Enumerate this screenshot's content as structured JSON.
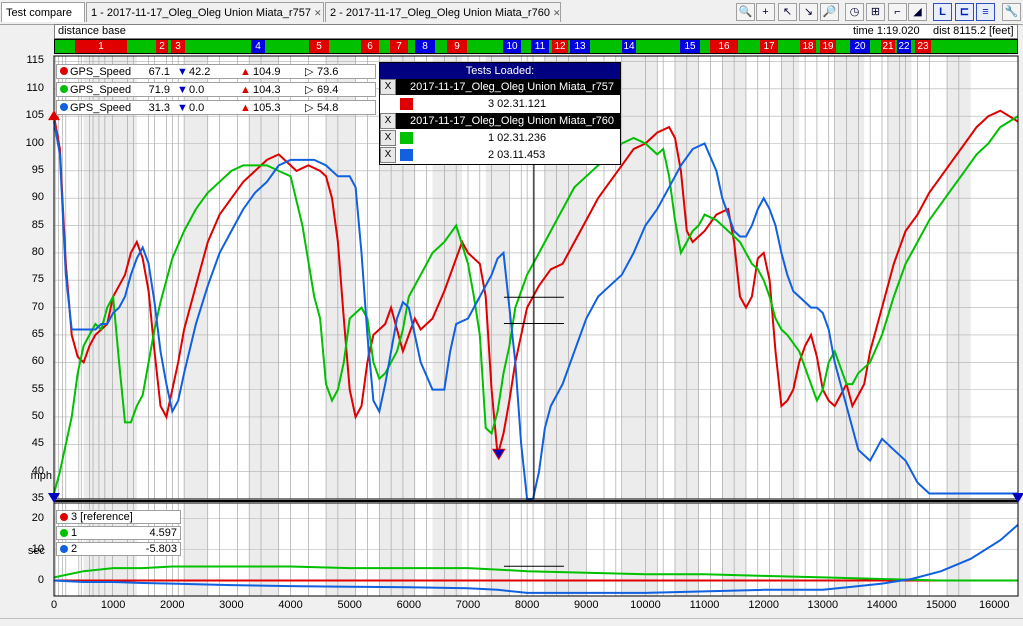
{
  "tabs": [
    {
      "label": "Test compare",
      "closable": false
    },
    {
      "label": "1 - 2017-11-17_Oleg_Oleg Union Miata_r757",
      "closable": true
    },
    {
      "label": "2 - 2017-11-17_Oleg_Oleg Union Miata_r760",
      "closable": true
    }
  ],
  "toolbar": {
    "buttons": [
      {
        "name": "zoom-in-icon",
        "glyph": "🔍"
      },
      {
        "name": "zoom-plus-icon",
        "glyph": "+"
      },
      {
        "name": "cursor-icon",
        "glyph": "↖"
      },
      {
        "name": "cursor-down-icon",
        "glyph": "↘"
      },
      {
        "name": "search-icon",
        "glyph": "🔎"
      },
      {
        "name": "clock-icon",
        "glyph": "◷"
      },
      {
        "name": "grid-icon",
        "glyph": "⊞"
      },
      {
        "name": "track-icon",
        "glyph": "⌐"
      },
      {
        "name": "triangle-icon",
        "glyph": "◢"
      },
      {
        "name": "layout-l-icon",
        "glyph": "L"
      },
      {
        "name": "layout-split-icon",
        "glyph": "⊏"
      },
      {
        "name": "layout-lines-icon",
        "glyph": "≡"
      },
      {
        "name": "wrench-icon",
        "glyph": "🔧"
      }
    ]
  },
  "infobar": {
    "label": "distance base",
    "time": "time 1:19.020",
    "dist": "dist 8115.2 [feet]"
  },
  "segments": [
    {
      "label": "1",
      "color": "#e00000"
    },
    {
      "label": "2",
      "color": "#e00000"
    },
    {
      "label": "3",
      "color": "#e00000"
    },
    {
      "label": "4",
      "color": "#0000e0"
    },
    {
      "label": "5",
      "color": "#e00000"
    },
    {
      "label": "6",
      "color": "#e00000"
    },
    {
      "label": "7",
      "color": "#e00000"
    },
    {
      "label": "8",
      "color": "#0000e0"
    },
    {
      "label": "9",
      "color": "#e00000"
    },
    {
      "label": "10",
      "color": "#0000e0"
    },
    {
      "label": "11",
      "color": "#0000e0"
    },
    {
      "label": "12",
      "color": "#e00000"
    },
    {
      "label": "13",
      "color": "#0000e0"
    },
    {
      "label": "14",
      "color": "#0000e0"
    },
    {
      "label": "15",
      "color": "#0000e0"
    },
    {
      "label": "16",
      "color": "#e00000"
    },
    {
      "label": "17",
      "color": "#e00000"
    },
    {
      "label": "18",
      "color": "#e00000"
    },
    {
      "label": "19",
      "color": "#e00000"
    },
    {
      "label": "20",
      "color": "#0000e0"
    },
    {
      "label": "21",
      "color": "#e00000"
    },
    {
      "label": "22",
      "color": "#0000e0"
    },
    {
      "label": "23",
      "color": "#e00000"
    }
  ],
  "legend": [
    {
      "name": "GPS_Speed",
      "value": "67.1",
      "min": "42.2",
      "max": "104.9",
      "avg": "73.6",
      "color": "#e00000"
    },
    {
      "name": "GPS_Speed",
      "value": "71.9",
      "min": "0.0",
      "max": "104.3",
      "avg": "69.4",
      "color": "#00c000"
    },
    {
      "name": "GPS_Speed",
      "value": "31.3",
      "min": "0.0",
      "max": "105.3",
      "avg": "54.8",
      "color": "#1060e0"
    }
  ],
  "tests_loaded": {
    "title": "Tests Loaded:",
    "groups": [
      {
        "session": "2017-11-17_Oleg_Oleg Union Miata_r757",
        "laps": [
          {
            "label": "3 02.31.121",
            "color": "#e00000"
          }
        ]
      },
      {
        "session": "2017-11-17_Oleg_Oleg Union Miata_r760",
        "laps": [
          {
            "label": "1 02.31.236",
            "color": "#00c000"
          },
          {
            "label": "2 03.11.453",
            "color": "#1060e0"
          }
        ]
      }
    ],
    "close_glyph": "X"
  },
  "bottom_legend": [
    {
      "label": "3 [reference]",
      "value": "",
      "color": "#e00000"
    },
    {
      "label": "1",
      "value": "4.597",
      "color": "#00c000"
    },
    {
      "label": "2",
      "value": "-5.803",
      "color": "#1060e0"
    }
  ],
  "chart_data": [
    {
      "type": "line",
      "ylabel": "mph",
      "xlabel": "",
      "ylim": [
        35,
        116
      ],
      "xlim": [
        0,
        16300
      ],
      "yticks": [
        35,
        40,
        45,
        50,
        55,
        60,
        65,
        70,
        75,
        80,
        85,
        90,
        95,
        100,
        105,
        110,
        115
      ],
      "xticks": [
        0,
        1000,
        2000,
        3000,
        4000,
        5000,
        6000,
        7000,
        8000,
        9000,
        10000,
        11000,
        12000,
        13000,
        14000,
        15000,
        16000
      ],
      "series": [
        {
          "name": "GPS_Speed",
          "color": "#e00000",
          "x": [
            0,
            100,
            200,
            300,
            400,
            500,
            600,
            700,
            800,
            900,
            1000,
            1100,
            1200,
            1300,
            1400,
            1500,
            1600,
            1700,
            1800,
            1900,
            2000,
            2100,
            2200,
            2400,
            2600,
            2800,
            3000,
            3200,
            3400,
            3600,
            3800,
            4000,
            4100,
            4300,
            4500,
            4600,
            4700,
            4800,
            4900,
            5000,
            5100,
            5200,
            5300,
            5400,
            5600,
            5700,
            5800,
            5900,
            6000,
            6100,
            6200,
            6400,
            6600,
            6800,
            6900,
            7000,
            7200,
            7300,
            7400,
            7500,
            7600,
            7700,
            7800,
            8000,
            8200,
            8400,
            8600,
            8800,
            9000,
            9200,
            9400,
            9600,
            9800,
            10000,
            10200,
            10400,
            10500,
            10600,
            10700,
            10800,
            10900,
            11000,
            11200,
            11400,
            11500,
            11600,
            11700,
            11800,
            11900,
            12000,
            12100,
            12200,
            12300,
            12400,
            12500,
            12600,
            12700,
            12800,
            12900,
            13000,
            13100,
            13200,
            13300,
            13400,
            13500,
            13600,
            13700,
            13800,
            14000,
            14200,
            14400,
            14600,
            14800,
            15000,
            15200,
            15400,
            15600,
            15800,
            16000,
            16300
          ],
          "y": [
            105,
            99,
            78,
            65,
            61,
            60,
            63,
            65,
            66,
            67,
            72,
            74,
            76,
            80,
            82,
            79,
            73,
            62,
            52,
            50,
            55,
            60,
            66,
            74,
            82,
            87,
            90,
            93,
            95,
            97,
            98,
            96,
            95,
            96,
            95,
            94,
            90,
            82,
            68,
            55,
            50,
            52,
            60,
            65,
            67,
            70,
            66,
            62,
            65,
            68,
            66,
            68,
            73,
            79,
            82,
            80,
            78,
            72,
            55,
            43,
            47,
            53,
            60,
            70,
            74,
            77,
            78,
            82,
            86,
            90,
            93,
            96,
            99,
            100,
            102,
            103,
            101,
            95,
            84,
            82,
            83,
            84,
            87,
            88,
            82,
            72,
            70,
            72,
            79,
            80,
            75,
            62,
            52,
            53,
            55,
            60,
            63,
            65,
            61,
            55,
            53,
            52,
            54,
            56,
            52,
            54,
            56,
            62,
            70,
            78,
            84,
            87,
            91,
            94,
            97,
            100,
            103,
            105,
            106,
            104
          ],
          "end_label": ""
        },
        {
          "name": "GPS_Speed",
          "color": "#00c000",
          "x": [
            0,
            100,
            200,
            300,
            400,
            500,
            600,
            700,
            800,
            900,
            1000,
            1100,
            1200,
            1300,
            1400,
            1500,
            1600,
            1700,
            1800,
            1900,
            2000,
            2200,
            2400,
            2600,
            2800,
            3000,
            3200,
            3400,
            3600,
            3800,
            4000,
            4200,
            4400,
            4500,
            4600,
            4700,
            4800,
            4900,
            5000,
            5100,
            5200,
            5300,
            5400,
            5500,
            5600,
            5700,
            5800,
            5900,
            6000,
            6200,
            6400,
            6600,
            6800,
            7000,
            7100,
            7200,
            7300,
            7400,
            7500,
            7600,
            7700,
            7800,
            8000,
            8200,
            8400,
            8600,
            8800,
            9000,
            9200,
            9400,
            9600,
            9800,
            10000,
            10200,
            10300,
            10400,
            10500,
            10600,
            10700,
            10800,
            10900,
            11000,
            11200,
            11400,
            11600,
            11800,
            11900,
            12000,
            12100,
            12200,
            12300,
            12400,
            12600,
            12800,
            12900,
            13000,
            13100,
            13200,
            13300,
            13400,
            13500,
            13600,
            13800,
            14000,
            14200,
            14400,
            14600,
            14800,
            15000,
            15200,
            15400,
            15600,
            15800,
            16000,
            16300
          ],
          "y": [
            36,
            40,
            45,
            50,
            58,
            63,
            65,
            67,
            66,
            70,
            72,
            60,
            49,
            49,
            52,
            54,
            60,
            66,
            71,
            75,
            79,
            84,
            88,
            91,
            93,
            95,
            96,
            96,
            96,
            95,
            94,
            85,
            72,
            68,
            56,
            53,
            55,
            60,
            68,
            69,
            70,
            68,
            60,
            57,
            58,
            60,
            62,
            66,
            72,
            76,
            80,
            82,
            85,
            78,
            72,
            65,
            48,
            47,
            51,
            58,
            63,
            70,
            76,
            80,
            84,
            88,
            92,
            94,
            96,
            98,
            100,
            101,
            100,
            98,
            99,
            94,
            86,
            80,
            82,
            84,
            85,
            87,
            86,
            84,
            82,
            78,
            77,
            75,
            72,
            68,
            66,
            65,
            62,
            56,
            53,
            55,
            60,
            62,
            59,
            56,
            56,
            58,
            60,
            65,
            72,
            78,
            82,
            86,
            89,
            92,
            95,
            98,
            100,
            103,
            105
          ],
          "end_label": ""
        },
        {
          "name": "GPS_Speed",
          "color": "#1060e0",
          "x": [
            0,
            100,
            200,
            300,
            400,
            500,
            600,
            700,
            800,
            900,
            1000,
            1100,
            1200,
            1300,
            1400,
            1500,
            1600,
            1700,
            1800,
            1900,
            2000,
            2100,
            2200,
            2400,
            2600,
            2800,
            3000,
            3200,
            3400,
            3600,
            3800,
            4000,
            4200,
            4400,
            4600,
            4800,
            5000,
            5100,
            5200,
            5300,
            5400,
            5500,
            5600,
            5700,
            5800,
            5900,
            6000,
            6100,
            6200,
            6400,
            6600,
            6700,
            6800,
            7000,
            7200,
            7400,
            7500,
            7600,
            7700,
            7800,
            7900,
            8000,
            8100,
            8200,
            8300,
            8400,
            8600,
            8800,
            9000,
            9200,
            9400,
            9600,
            9800,
            10000,
            10200,
            10400,
            10600,
            10800,
            11000,
            11200,
            11300,
            11400,
            11500,
            11600,
            11700,
            11800,
            11900,
            12000,
            12100,
            12200,
            12300,
            12400,
            12500,
            12600,
            12700,
            12800,
            12900,
            13000,
            13100,
            13200,
            13300,
            13400,
            13500,
            13600,
            13800,
            14000,
            14200,
            14400,
            14600,
            14800,
            15000,
            15200,
            15400,
            15600,
            15800,
            16000,
            16300
          ],
          "y": [
            104,
            98,
            76,
            66,
            66,
            66,
            66,
            66,
            67,
            67,
            69,
            70,
            72,
            76,
            79,
            81,
            78,
            71,
            62,
            56,
            51,
            53,
            58,
            67,
            74,
            80,
            84,
            88,
            91,
            93,
            96,
            97,
            97,
            97,
            96,
            94,
            94,
            92,
            80,
            65,
            53,
            51,
            56,
            62,
            68,
            71,
            70,
            65,
            60,
            55,
            55,
            62,
            67,
            68,
            72,
            76,
            79,
            80,
            70,
            60,
            45,
            35,
            30,
            40,
            48,
            52,
            56,
            62,
            68,
            72,
            74,
            76,
            80,
            85,
            88,
            92,
            96,
            99,
            100,
            95,
            90,
            87,
            84,
            83,
            83,
            85,
            88,
            90,
            88,
            85,
            80,
            76,
            73,
            72,
            71,
            70,
            70,
            69,
            66,
            60,
            56,
            52,
            48,
            44,
            42,
            46,
            44,
            42,
            38,
            36,
            36,
            36,
            36,
            36,
            36,
            36,
            36
          ],
          "end_label": ""
        }
      ]
    },
    {
      "type": "line",
      "ylabel": "sec",
      "xlabel": "",
      "ylim": [
        -5,
        25
      ],
      "xlim": [
        0,
        16300
      ],
      "yticks": [
        0,
        10,
        20
      ],
      "xticks": [
        0,
        1000,
        2000,
        3000,
        4000,
        5000,
        6000,
        7000,
        8000,
        9000,
        10000,
        11000,
        12000,
        13000,
        14000,
        15000,
        16000
      ],
      "series": [
        {
          "name": "3 [reference]",
          "color": "#e00000",
          "x": [
            0,
            16300
          ],
          "y": [
            0,
            0
          ]
        },
        {
          "name": "1",
          "color": "#00c000",
          "x": [
            0,
            500,
            1000,
            1500,
            2000,
            3000,
            4000,
            5000,
            6000,
            7000,
            7500,
            8000,
            9000,
            10000,
            11000,
            12000,
            13000,
            14000,
            15000,
            16000,
            16300
          ],
          "y": [
            1,
            3,
            4,
            4,
            4.5,
            4.5,
            4.5,
            4,
            4,
            4,
            3.5,
            3,
            2.5,
            2,
            2,
            1.5,
            1,
            0.5,
            0,
            0,
            0
          ]
        },
        {
          "name": "2",
          "color": "#1060e0",
          "x": [
            0,
            500,
            1000,
            1500,
            2000,
            3000,
            4000,
            5000,
            6000,
            7000,
            7500,
            8000,
            9000,
            10000,
            11000,
            12000,
            13000,
            13500,
            14000,
            14500,
            15000,
            15500,
            16000,
            16300
          ],
          "y": [
            0,
            -0.5,
            -0.5,
            -0.8,
            -1,
            -1.5,
            -1.8,
            -2,
            -2.2,
            -2.5,
            -3,
            -4,
            -4,
            -4,
            -3.5,
            -3,
            -3,
            -2,
            -1,
            0.5,
            3,
            7,
            13,
            18
          ]
        }
      ]
    }
  ]
}
